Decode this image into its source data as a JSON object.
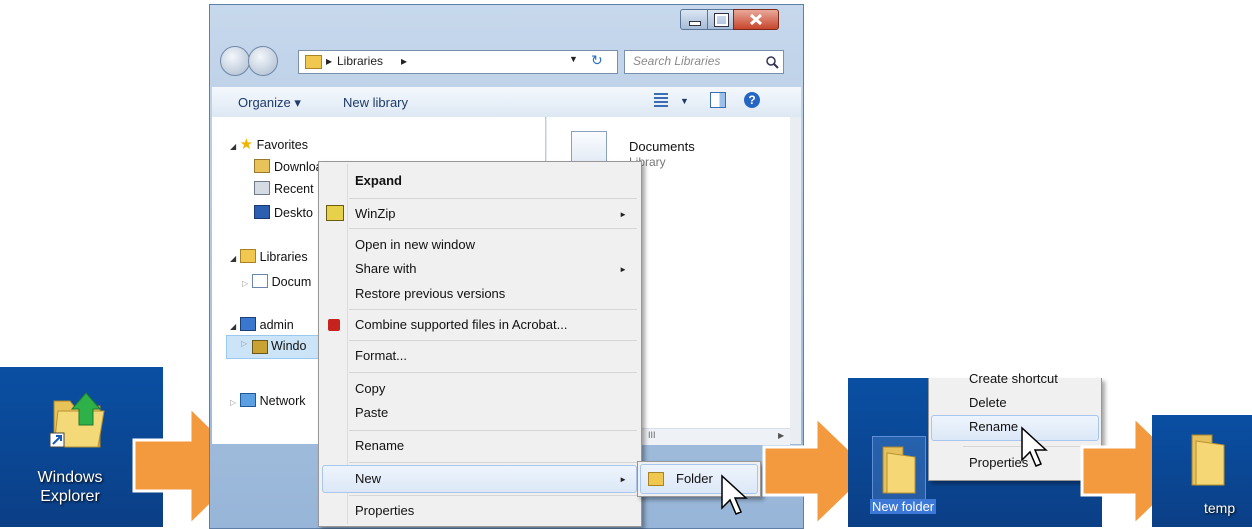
{
  "desktop1": {
    "icon": "windows-explorer-icon",
    "label_line1": "Windows",
    "label_line2": "Explorer"
  },
  "explorer": {
    "breadcrumb_sep": "▸",
    "breadcrumb": "Libraries",
    "search_placeholder": "Search Libraries",
    "toolbar": {
      "organize": "Organize ▾",
      "new_library": "New library"
    },
    "tree": {
      "favorites": "Favorites",
      "downloads": "Downloads",
      "recent": "Recent",
      "desktop": "Deskto",
      "libraries": "Libraries",
      "documents": "Docum",
      "admin": "admin",
      "windows": "Windo",
      "network": "Network"
    },
    "content": {
      "documents_title": "Documents",
      "documents_sub": "Library"
    },
    "scroll_glyph": "III"
  },
  "context_menu": {
    "expand": "Expand",
    "winzip": "WinZip",
    "open_new_window": "Open in new window",
    "share_with": "Share with",
    "restore": "Restore previous versions",
    "combine": "Combine supported files in Acrobat...",
    "format": "Format...",
    "copy": "Copy",
    "paste": "Paste",
    "rename": "Rename",
    "new": "New",
    "properties": "Properties",
    "submenu_arrow": "►"
  },
  "new_submenu": {
    "folder": "Folder"
  },
  "desktop3": {
    "menu_partial": "Create shortcut",
    "delete": "Delete",
    "rename": "Rename",
    "properties": "Properties",
    "folder_label": "New folder"
  },
  "desktop4": {
    "folder_label": "temp"
  },
  "colors": {
    "arrow": "#f39a3f",
    "arrow_border": "#ffffff",
    "desktop": "#0b4a9c"
  }
}
